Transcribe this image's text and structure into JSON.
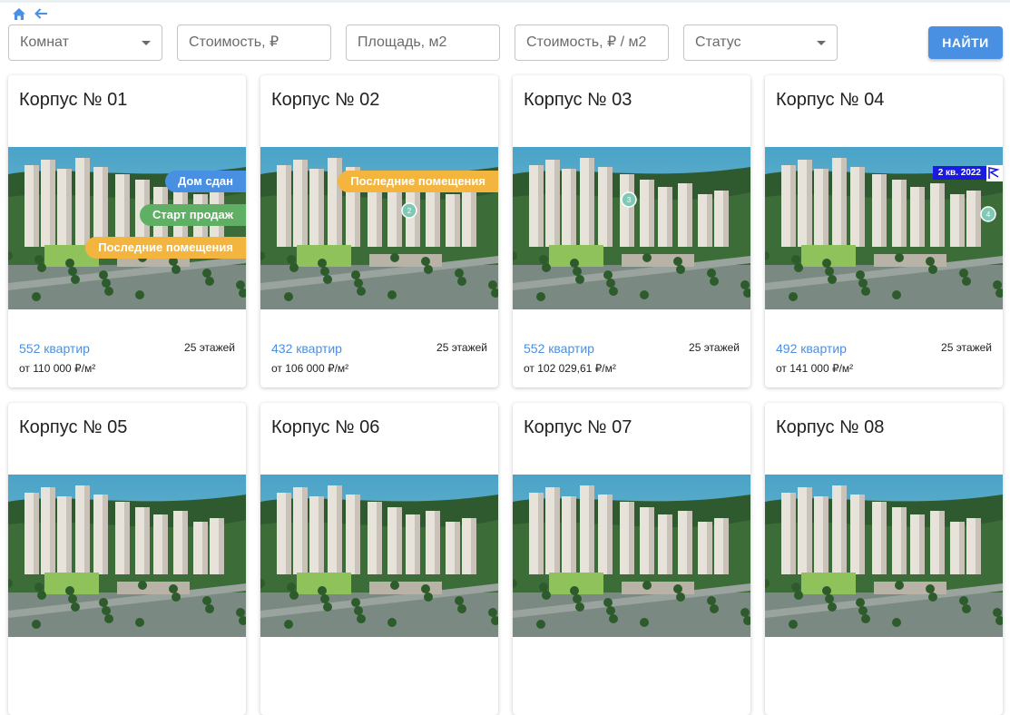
{
  "filters": {
    "rooms": "Комнат",
    "price": "Стоимость, ₽",
    "area": "Площадь, м2",
    "price_per_m2": "Стоимость, ₽ / м2",
    "status": "Статус"
  },
  "find_button": "НАЙТИ",
  "cards": [
    {
      "title": "Корпус № 01",
      "apartments": "552 квартир",
      "floors": "25 этажей",
      "price": "от 110 000 ₽/м²",
      "badges": [
        "Дом сдан",
        "Старт продаж",
        "Последние помещения"
      ]
    },
    {
      "title": "Корпус № 02",
      "apartments": "432 квартир",
      "floors": "25 этажей",
      "price": "от 106 000 ₽/м²",
      "badges": [
        "Последние помещения"
      ],
      "marker": "2"
    },
    {
      "title": "Корпус № 03",
      "apartments": "552 квартир",
      "floors": "25 этажей",
      "price": "от 102 029,61 ₽/м²",
      "marker": "3"
    },
    {
      "title": "Корпус № 04",
      "apartments": "492 квартир",
      "floors": "25 этажей",
      "price": "от 141 000 ₽/м²",
      "tag": "2 кв. 2022",
      "marker": "4"
    },
    {
      "title": "Корпус № 05"
    },
    {
      "title": "Корпус № 06"
    },
    {
      "title": "Корпус № 07"
    },
    {
      "title": "Корпус № 08"
    }
  ],
  "colors": {
    "accent": "#4a90e2",
    "badge_done": "#4a90e2",
    "badge_start": "#5fb064",
    "badge_last": "#f4b53f",
    "tag": "#1a1ae0"
  },
  "icons": {
    "home": "home-icon",
    "back": "arrow-left-icon"
  }
}
